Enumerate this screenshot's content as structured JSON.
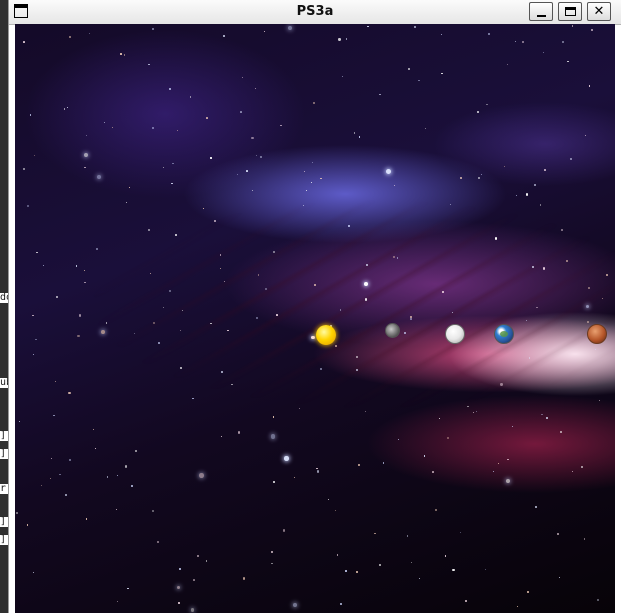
{
  "window": {
    "title": "PS3a",
    "buttons": {
      "close_glyph": "✕"
    }
  },
  "background_terminal": {
    "fragments": [
      "do",
      "ub",
      "]",
      "]",
      "r",
      "]",
      "]"
    ]
  },
  "simulation": {
    "bodies": [
      {
        "name": "sun",
        "icon": "sun-icon"
      },
      {
        "name": "mercury",
        "icon": "mercury-icon"
      },
      {
        "name": "venus",
        "icon": "venus-icon"
      },
      {
        "name": "earth",
        "icon": "earth-icon"
      },
      {
        "name": "mars",
        "icon": "mars-icon"
      }
    ],
    "colors": {
      "space": "#120820",
      "nebula_blue": "#6e6eeb",
      "nebula_pink": "#ff5a96"
    }
  }
}
